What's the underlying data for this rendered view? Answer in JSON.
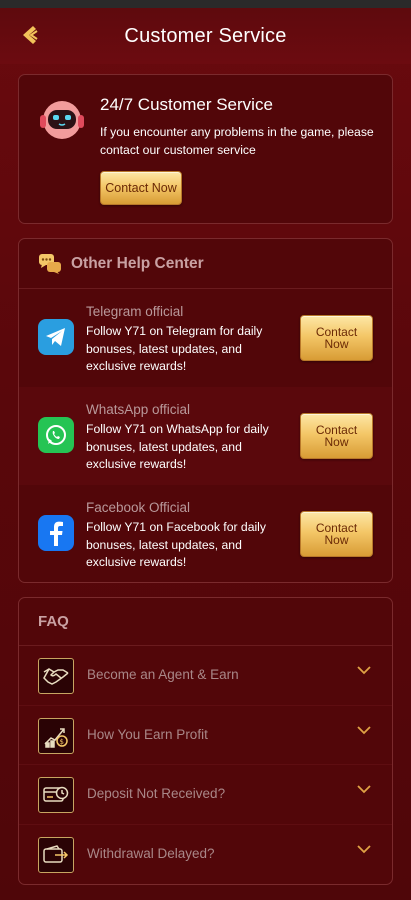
{
  "header": {
    "title": "Customer Service"
  },
  "customer_service": {
    "title": "24/7 Customer Service",
    "description": "If you encounter any problems in the game, please contact our customer service",
    "button_label": "Contact Now"
  },
  "help_center": {
    "title": "Other Help Center",
    "items": [
      {
        "name": "Telegram official",
        "description": "Follow Y71 on Telegram for daily bonuses, latest updates, and exclusive rewards!",
        "button_label": "Contact Now",
        "icon": "telegram-icon"
      },
      {
        "name": "WhatsApp official",
        "description": "Follow Y71 on WhatsApp for daily bonuses, latest updates, and exclusive rewards!",
        "button_label": "Contact Now",
        "icon": "whatsapp-icon"
      },
      {
        "name": "Facebook Official",
        "description": "Follow Y71 on Facebook for daily bonuses, latest updates, and exclusive rewards!",
        "button_label": "Contact Now",
        "icon": "facebook-icon"
      }
    ]
  },
  "faq": {
    "title": "FAQ",
    "items": [
      {
        "label": "Become an Agent & Earn",
        "icon": "handshake-icon"
      },
      {
        "label": "How You Earn Profit",
        "icon": "profit-chart-icon"
      },
      {
        "label": "Deposit Not Received?",
        "icon": "card-clock-icon"
      },
      {
        "label": "Withdrawal Delayed?",
        "icon": "wallet-transfer-icon"
      }
    ]
  },
  "colors": {
    "background": "#5a070b",
    "gold": "#f4c768",
    "muted_text": "#b9999b",
    "telegram": "#2a9ee0",
    "whatsapp": "#25c454",
    "facebook": "#1877f2"
  }
}
